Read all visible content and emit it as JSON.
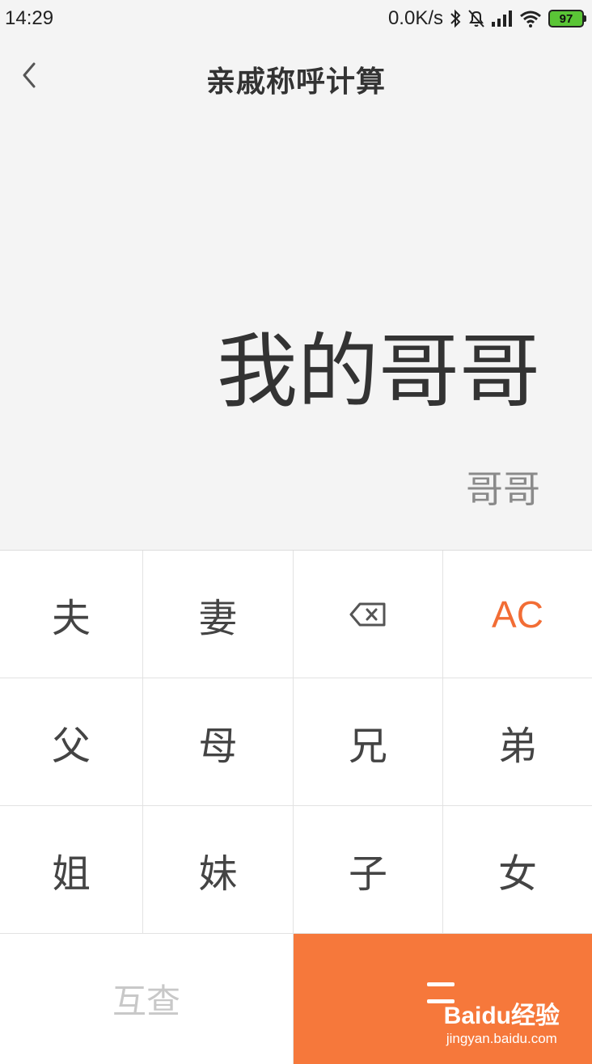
{
  "status_bar": {
    "time": "14:29",
    "net_speed": "0.0K/s",
    "battery": "97",
    "icons": [
      "bluetooth-icon",
      "bell-off-icon",
      "signal-icon",
      "wifi-icon",
      "battery-icon"
    ]
  },
  "header": {
    "title": "亲戚称呼计算",
    "back_icon": "chevron-left-icon"
  },
  "display": {
    "expression": "我的哥哥",
    "result": "哥哥"
  },
  "keypad": {
    "rows": [
      [
        "夫",
        "妻",
        "⌫",
        "AC"
      ],
      [
        "父",
        "母",
        "兄",
        "弟"
      ],
      [
        "姐",
        "妹",
        "子",
        "女"
      ]
    ],
    "mutual_label": "互查",
    "equals_icon": "equals-icon"
  },
  "watermark": {
    "logo": "Baidu经验",
    "url": "jingyan.baidu.com"
  },
  "colors": {
    "accent": "#f6783b",
    "ac_text": "#f26d35",
    "background": "#f4f4f4"
  }
}
